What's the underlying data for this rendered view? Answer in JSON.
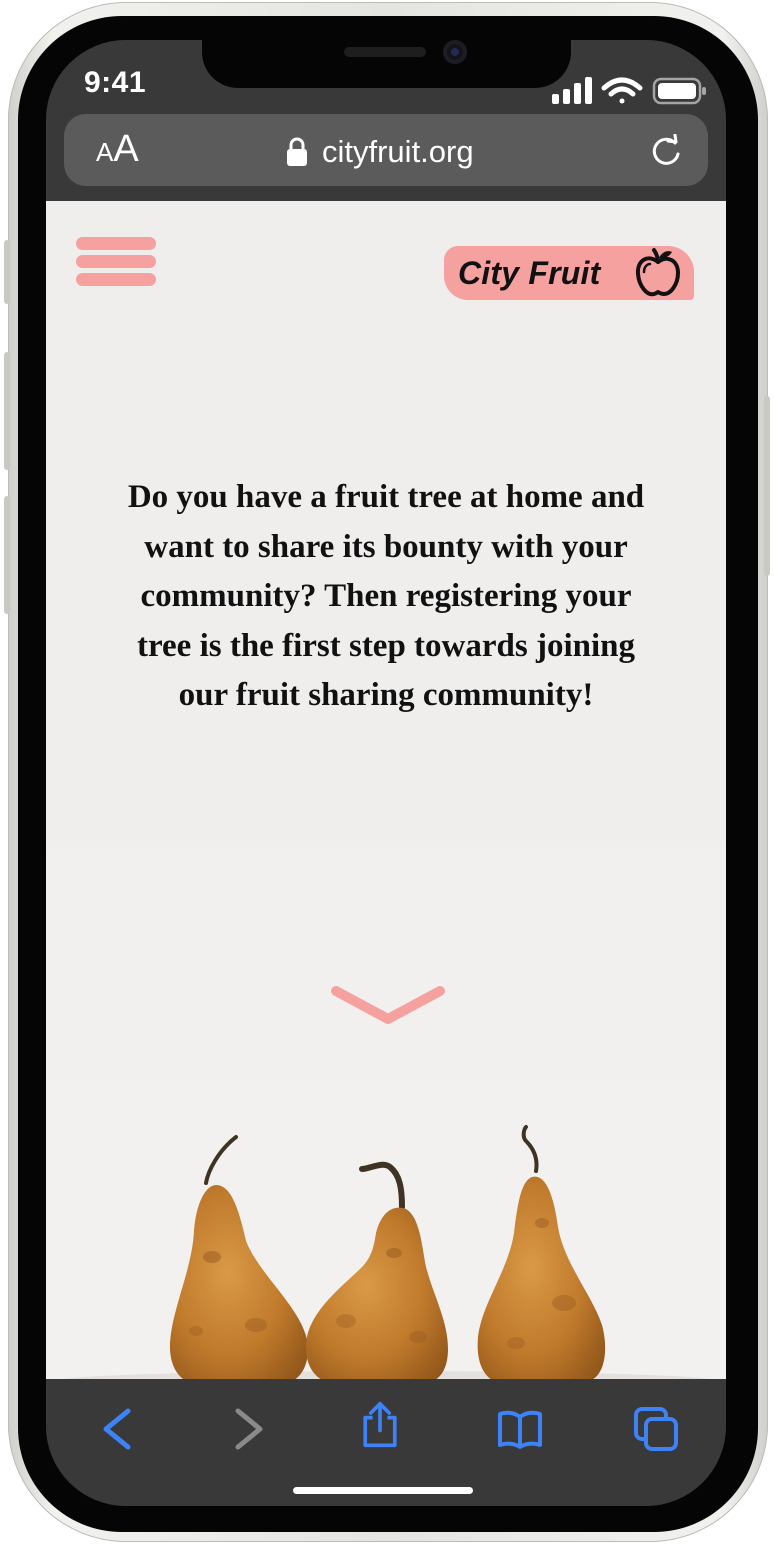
{
  "status_bar": {
    "time": "9:41"
  },
  "address_bar": {
    "text_size_small": "A",
    "text_size_large": "A",
    "url": "cityfruit.org",
    "lock_icon": "lock-icon",
    "reload_icon": "reload-icon"
  },
  "header": {
    "menu_icon": "hamburger-menu-icon",
    "logo_text": "City Fruit",
    "logo_icon": "apple-icon"
  },
  "main": {
    "intro_text": "Do you have a fruit tree at home and want to share its bounty with your community? Then registering your tree is the first step towards joining our fruit sharing community!",
    "scroll_icon": "chevron-down-icon",
    "image_subject": "three pears"
  },
  "toolbar": {
    "back_icon": "back-arrow-icon",
    "forward_icon": "forward-arrow-icon",
    "share_icon": "share-icon",
    "bookmarks_icon": "book-icon",
    "tabs_icon": "tabs-icon"
  },
  "colors": {
    "accent_pink": "#f4a19f",
    "chrome_dark": "#393939",
    "toolbar_blue": "#3d82f6",
    "toolbar_disabled": "#8a8a8a"
  }
}
